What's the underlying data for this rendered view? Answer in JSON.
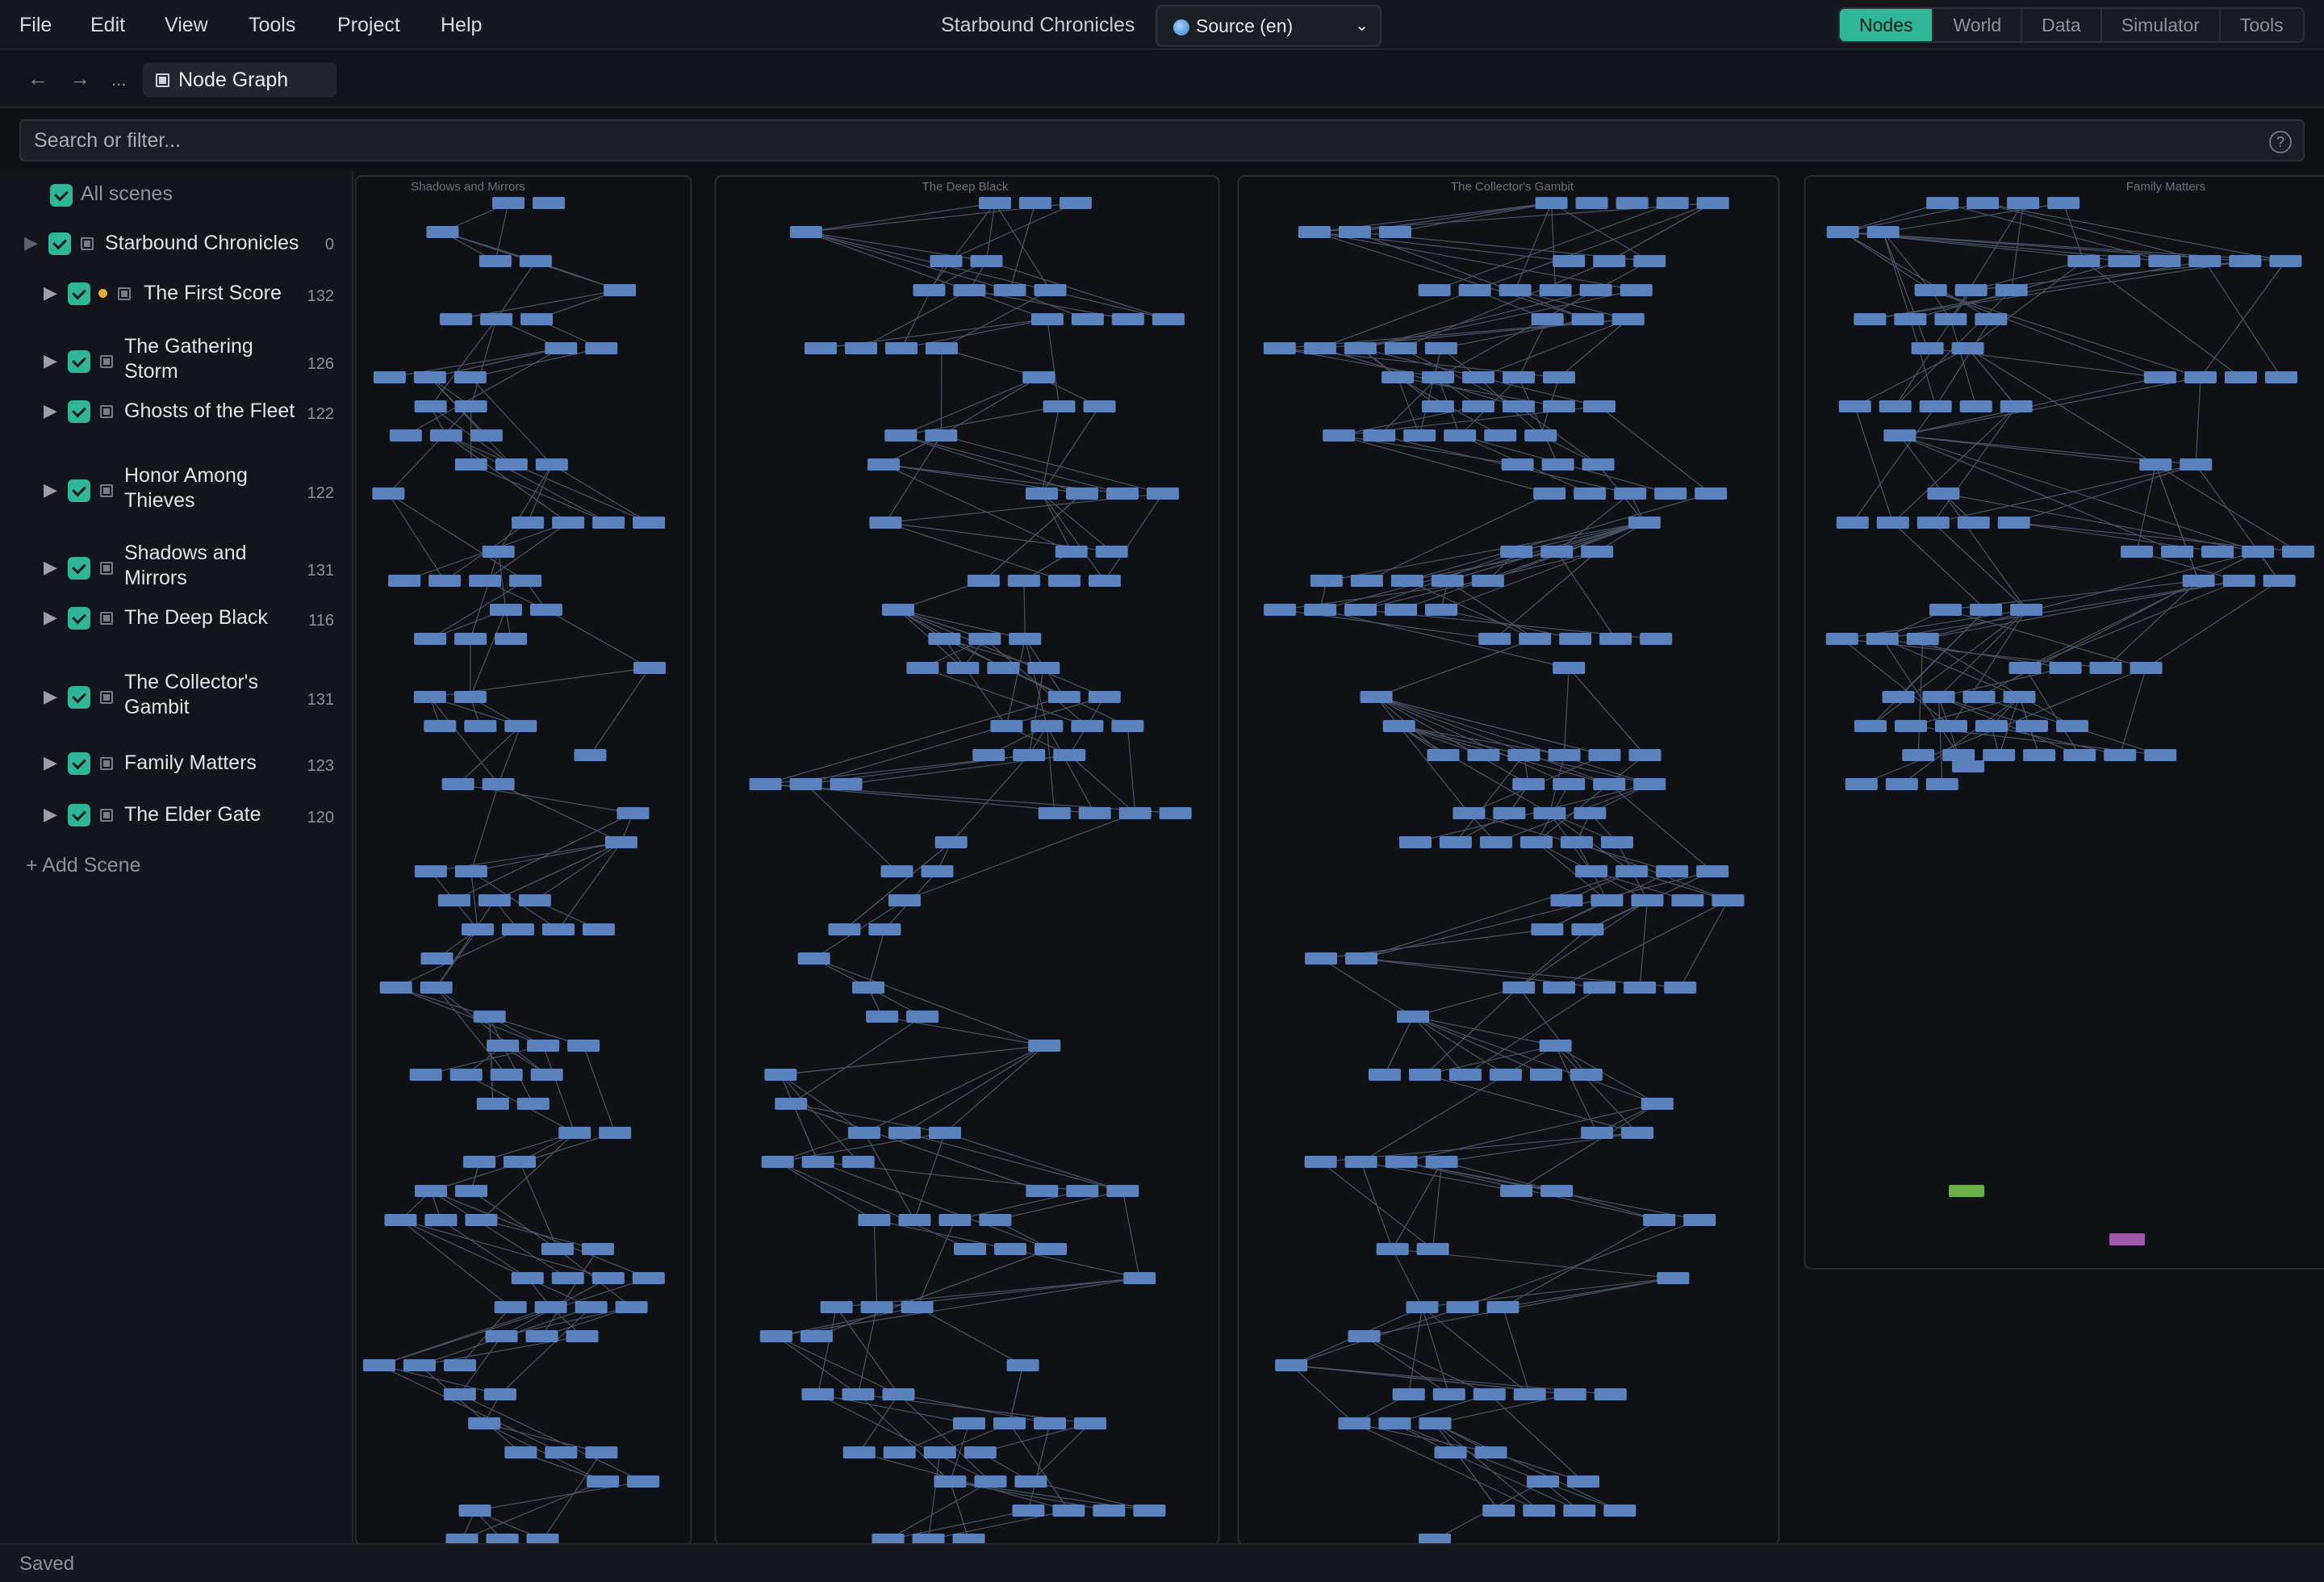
{
  "menu": [
    "File",
    "Edit",
    "View",
    "Tools",
    "Project",
    "Help"
  ],
  "app_title": "Starbound Chronicles",
  "locale": {
    "label": "Source (en)"
  },
  "view_tabs": [
    {
      "label": "Nodes",
      "active": true
    },
    {
      "label": "World",
      "active": false
    },
    {
      "label": "Data",
      "active": false
    },
    {
      "label": "Simulator",
      "active": false
    },
    {
      "label": "Tools",
      "active": false
    }
  ],
  "breadcrumb": {
    "more": "...",
    "current": "Node Graph"
  },
  "search": {
    "placeholder": "Search or filter...",
    "help": "?"
  },
  "sidebar": {
    "all_label": "All scenes",
    "root": {
      "label": "Starbound Chronicles",
      "count": "0"
    },
    "scenes": [
      {
        "lines": [
          "The First Score"
        ],
        "count": "132",
        "modified": true
      },
      {
        "lines": [
          "The Gathering",
          "Storm"
        ],
        "count": "126",
        "modified": false
      },
      {
        "lines": [
          "Ghosts of the Fleet"
        ],
        "count": "122",
        "modified": false
      },
      {
        "lines": [
          "Honor Among",
          "Thieves"
        ],
        "count": "122",
        "modified": false
      },
      {
        "lines": [
          "Shadows and",
          "Mirrors"
        ],
        "count": "131",
        "modified": false
      },
      {
        "lines": [
          "The Deep Black"
        ],
        "count": "116",
        "modified": false
      },
      {
        "lines": [
          "The Collector's",
          "Gambit"
        ],
        "count": "131",
        "modified": false
      },
      {
        "lines": [
          "Family Matters"
        ],
        "count": "123",
        "modified": false
      },
      {
        "lines": [
          "The Elder Gate"
        ],
        "count": "120",
        "modified": false
      }
    ],
    "add_label": "+ Add Scene"
  },
  "graph": {
    "groups": [
      "Shadows and Mirrors",
      "The Deep Black",
      "The Collector's Gambit",
      "Family Matters"
    ],
    "colors": {
      "node": "#5b82bd",
      "node_start": "#6cae4a",
      "node_end": "#a05aa8",
      "edge": "#4a5366",
      "frame": "#272b33",
      "label": "#6c717b"
    }
  },
  "status": "Saved"
}
